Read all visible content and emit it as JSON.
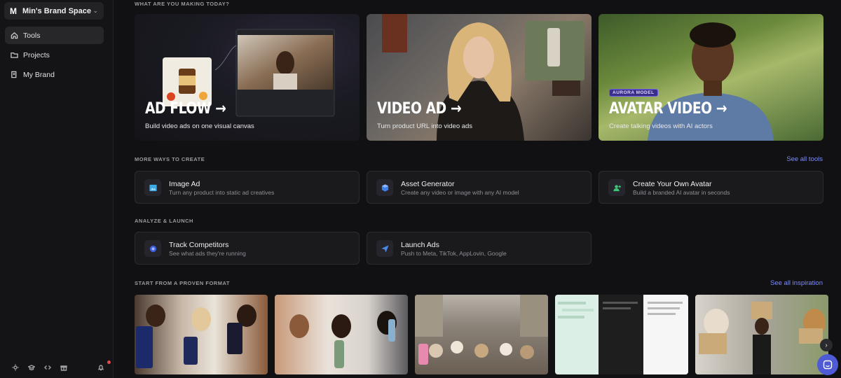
{
  "sidebar": {
    "workspace_initial": "M",
    "workspace_name": "Min's Brand Space",
    "items": [
      {
        "label": "Tools",
        "icon": "home-icon",
        "active": true
      },
      {
        "label": "Projects",
        "icon": "folder-icon",
        "active": false
      },
      {
        "label": "My Brand",
        "icon": "book-icon",
        "active": false
      }
    ],
    "bottom_icons": [
      "theme-icon",
      "learn-icon",
      "code-icon",
      "gift-icon",
      "bell-icon"
    ]
  },
  "sections": {
    "making": "WHAT ARE YOU MAKING TODAY?",
    "more_ways": "MORE WAYS TO CREATE",
    "analyze": "ANALYZE & LAUNCH",
    "proven": "START FROM A PROVEN FORMAT"
  },
  "links": {
    "see_all_tools": "See all tools",
    "see_all_inspiration": "See all inspiration"
  },
  "hero_cards": [
    {
      "title": "AD FLOW →",
      "subtitle": "Build video ads on one visual canvas"
    },
    {
      "title": "VIDEO AD →",
      "subtitle": "Turn product URL into video ads"
    },
    {
      "title": "AVATAR VIDEO →",
      "subtitle": "Create talking videos with AI actors",
      "badge": "AURORA MODEL"
    }
  ],
  "create_cards": [
    {
      "title": "Image Ad",
      "subtitle": "Turn any product into static ad creatives",
      "icon": "image-icon"
    },
    {
      "title": "Asset Generator",
      "subtitle": "Create any video or image with any AI model",
      "icon": "cube-icon"
    },
    {
      "title": "Create Your Own Avatar",
      "subtitle": "Build a branded AI avatar in seconds",
      "icon": "user-plus-icon"
    }
  ],
  "analyze_cards": [
    {
      "title": "Track Competitors",
      "subtitle": "See what ads they're running",
      "icon": "target-icon"
    },
    {
      "title": "Launch Ads",
      "subtitle": "Push to Meta, TikTok, AppLovin, Google",
      "icon": "send-icon"
    }
  ],
  "colors": {
    "accent": "#7b8cff",
    "background": "#111113",
    "card": "#1a1a1d"
  }
}
